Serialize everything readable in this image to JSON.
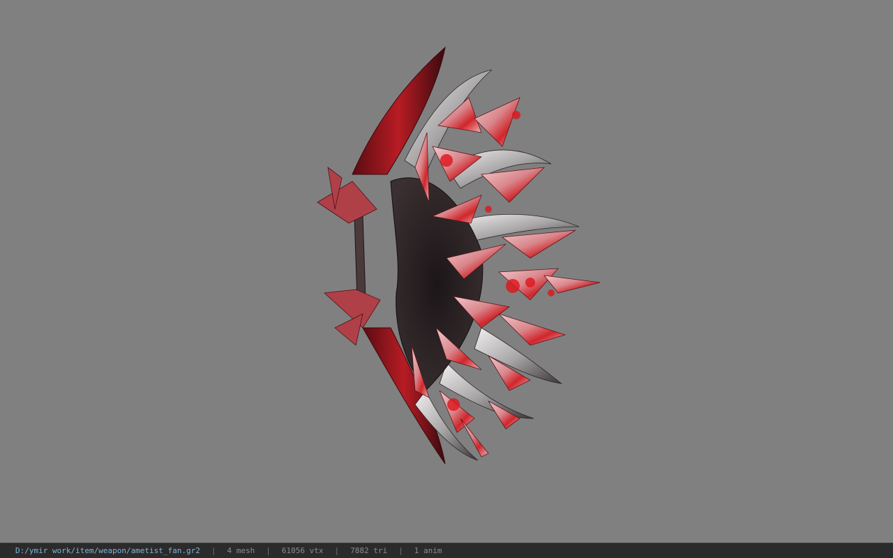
{
  "viewer": {
    "background_color": "#808080",
    "model_name": "ametist_fan"
  },
  "status": {
    "path": "D:/ymir work/item/weapon/ametist_fan.gr2",
    "mesh": "4 mesh",
    "vtx": "61056 vtx",
    "tri": "7882 tri",
    "anim": "1 anim",
    "separator": "|"
  },
  "colors": {
    "status_bg": "#2b2b2b",
    "path_text": "#7fb5d9",
    "stat_text": "#8c8c8c",
    "crystal_red": "#d0262b",
    "crystal_pale": "#e6b3b6",
    "dark_body": "#2a2224",
    "blade_silver": "#c8c4c6"
  }
}
